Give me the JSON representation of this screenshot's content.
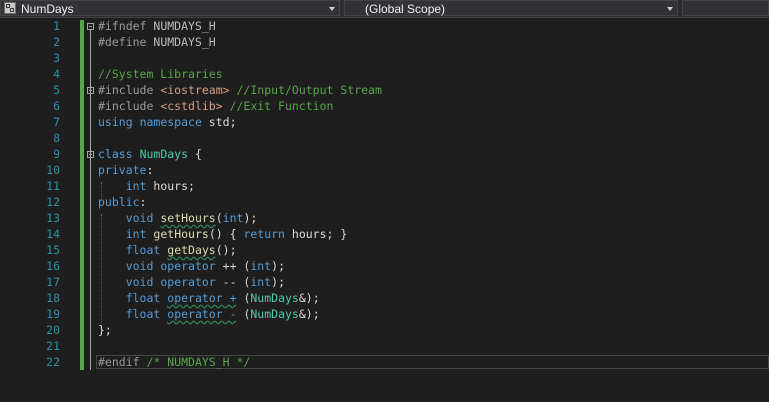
{
  "navbar": {
    "class_dropdown": "NumDays",
    "scope_dropdown": "(Global Scope)"
  },
  "colors": {
    "background": "#1e1e1e",
    "line_numbers": "#2b91af",
    "keyword": "#569cd6",
    "comment": "#57a64a",
    "type": "#4ec9b0",
    "function": "#dcdcaa",
    "string": "#d69d85",
    "change_bar": "#57a64a"
  },
  "lines": [
    {
      "n": "1",
      "tokens": [
        {
          "t": "#ifndef",
          "c": "pp"
        },
        {
          "t": " NUMDAYS_H",
          "c": "mc"
        }
      ]
    },
    {
      "n": "2",
      "tokens": [
        {
          "t": "#define",
          "c": "pp"
        },
        {
          "t": " NUMDAYS_H",
          "c": "mc"
        }
      ]
    },
    {
      "n": "3",
      "tokens": []
    },
    {
      "n": "4",
      "tokens": [
        {
          "t": "//System Libraries",
          "c": "cm"
        }
      ]
    },
    {
      "n": "5",
      "tokens": [
        {
          "t": "#include",
          "c": "pp"
        },
        {
          "t": " ",
          "c": "nm"
        },
        {
          "t": "<iostream>",
          "c": "st"
        },
        {
          "t": " //Input/Output Stream",
          "c": "cm"
        }
      ]
    },
    {
      "n": "6",
      "tokens": [
        {
          "t": "#include",
          "c": "pp"
        },
        {
          "t": " ",
          "c": "nm"
        },
        {
          "t": "<cstdlib>",
          "c": "st"
        },
        {
          "t": " //Exit Function",
          "c": "cm"
        }
      ]
    },
    {
      "n": "7",
      "tokens": [
        {
          "t": "using",
          "c": "kw"
        },
        {
          "t": " ",
          "c": "nm"
        },
        {
          "t": "namespace",
          "c": "kw"
        },
        {
          "t": " std;",
          "c": "nm"
        }
      ]
    },
    {
      "n": "8",
      "tokens": []
    },
    {
      "n": "9",
      "tokens": [
        {
          "t": "class",
          "c": "kw"
        },
        {
          "t": " ",
          "c": "nm"
        },
        {
          "t": "NumDays",
          "c": "ty"
        },
        {
          "t": " {",
          "c": "nm"
        }
      ]
    },
    {
      "n": "10",
      "tokens": [
        {
          "t": "private",
          "c": "kw"
        },
        {
          "t": ":",
          "c": "nm"
        }
      ]
    },
    {
      "n": "11",
      "tokens": [
        {
          "t": "    ",
          "c": "nm"
        },
        {
          "t": "int",
          "c": "kw"
        },
        {
          "t": " hours;",
          "c": "nm"
        }
      ]
    },
    {
      "n": "12",
      "tokens": [
        {
          "t": "public",
          "c": "kw"
        },
        {
          "t": ":",
          "c": "nm"
        }
      ]
    },
    {
      "n": "13",
      "tokens": [
        {
          "t": "    ",
          "c": "nm"
        },
        {
          "t": "void",
          "c": "kw"
        },
        {
          "t": " ",
          "c": "nm"
        },
        {
          "t": "setHours",
          "c": "fn",
          "sq": true
        },
        {
          "t": "(",
          "c": "nm"
        },
        {
          "t": "int",
          "c": "kw"
        },
        {
          "t": ");",
          "c": "nm"
        }
      ]
    },
    {
      "n": "14",
      "tokens": [
        {
          "t": "    ",
          "c": "nm"
        },
        {
          "t": "int",
          "c": "kw"
        },
        {
          "t": " ",
          "c": "nm"
        },
        {
          "t": "getHours",
          "c": "fn"
        },
        {
          "t": "() { ",
          "c": "nm"
        },
        {
          "t": "return",
          "c": "kw"
        },
        {
          "t": " hours; }",
          "c": "nm"
        }
      ]
    },
    {
      "n": "15",
      "tokens": [
        {
          "t": "    ",
          "c": "nm"
        },
        {
          "t": "float",
          "c": "kw"
        },
        {
          "t": " ",
          "c": "nm"
        },
        {
          "t": "getDays",
          "c": "fn",
          "sq": true
        },
        {
          "t": "();",
          "c": "nm"
        }
      ]
    },
    {
      "n": "16",
      "tokens": [
        {
          "t": "    ",
          "c": "nm"
        },
        {
          "t": "void",
          "c": "kw"
        },
        {
          "t": " ",
          "c": "nm"
        },
        {
          "t": "operator",
          "c": "kw"
        },
        {
          "t": " ++ (",
          "c": "nm"
        },
        {
          "t": "int",
          "c": "kw"
        },
        {
          "t": ");",
          "c": "nm"
        }
      ]
    },
    {
      "n": "17",
      "tokens": [
        {
          "t": "    ",
          "c": "nm"
        },
        {
          "t": "void",
          "c": "kw"
        },
        {
          "t": " ",
          "c": "nm"
        },
        {
          "t": "operator",
          "c": "kw"
        },
        {
          "t": " -- (",
          "c": "nm"
        },
        {
          "t": "int",
          "c": "kw"
        },
        {
          "t": ");",
          "c": "nm"
        }
      ]
    },
    {
      "n": "18",
      "tokens": [
        {
          "t": "    ",
          "c": "nm"
        },
        {
          "t": "float",
          "c": "kw"
        },
        {
          "t": " ",
          "c": "nm"
        },
        {
          "t": "operator +",
          "c": "kw",
          "sq": true
        },
        {
          "t": " (",
          "c": "nm"
        },
        {
          "t": "NumDays",
          "c": "ty"
        },
        {
          "t": "&);",
          "c": "nm"
        }
      ]
    },
    {
      "n": "19",
      "tokens": [
        {
          "t": "    ",
          "c": "nm"
        },
        {
          "t": "float",
          "c": "kw"
        },
        {
          "t": " ",
          "c": "nm"
        },
        {
          "t": "operator -",
          "c": "kw",
          "sq": true
        },
        {
          "t": " (",
          "c": "nm"
        },
        {
          "t": "NumDays",
          "c": "ty"
        },
        {
          "t": "&);",
          "c": "nm"
        }
      ]
    },
    {
      "n": "20",
      "tokens": [
        {
          "t": "};",
          "c": "nm"
        }
      ]
    },
    {
      "n": "21",
      "tokens": []
    },
    {
      "n": "22",
      "tokens": [
        {
          "t": "#endif",
          "c": "pp"
        },
        {
          "t": " ",
          "c": "nm"
        },
        {
          "t": "/* NUMDAYS_H */",
          "c": "cm"
        }
      ]
    }
  ]
}
